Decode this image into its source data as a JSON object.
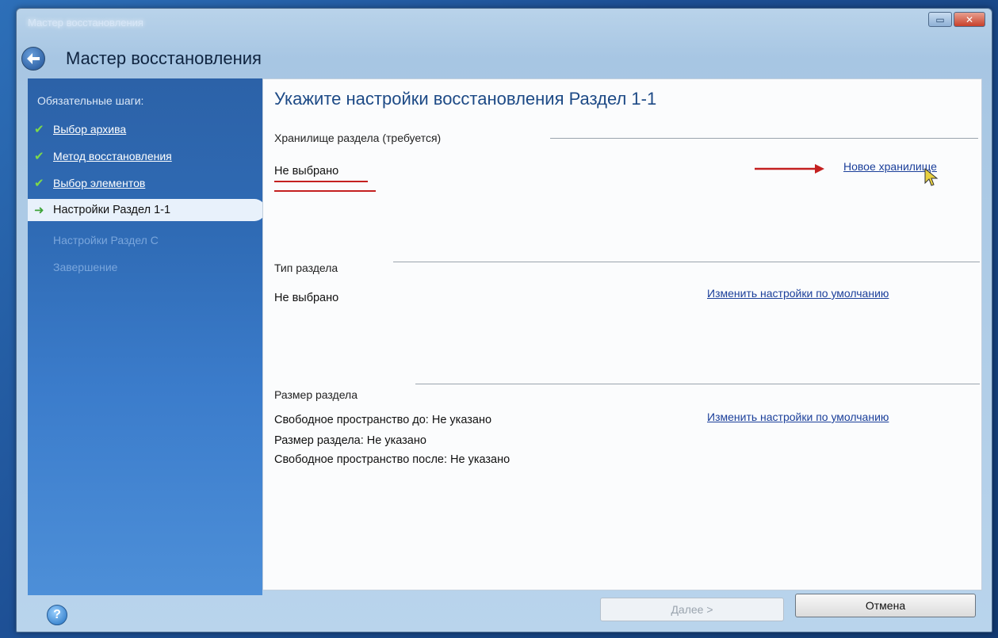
{
  "window": {
    "titlebar_text": "Мастер восстановления",
    "header_title": "Мастер восстановления"
  },
  "sidebar": {
    "heading": "Обязательные шаги:",
    "steps": [
      {
        "label": "Выбор архива",
        "state": "done"
      },
      {
        "label": "Метод восстановления",
        "state": "done"
      },
      {
        "label": "Выбор элементов",
        "state": "done"
      },
      {
        "label": "Настройки Раздел 1-1",
        "state": "current"
      },
      {
        "label": "Настройки Раздел С",
        "state": "future"
      },
      {
        "label": "Завершение",
        "state": "future"
      }
    ]
  },
  "main": {
    "page_title": "Укажите настройки восстановления Раздел 1-1",
    "storage": {
      "label": "Хранилище раздела (требуется)",
      "value": "Не выбрано",
      "link": "Новое хранилище"
    },
    "type": {
      "label": "Тип раздела",
      "value": "Не выбрано",
      "link": "Изменить настройки по умолчанию"
    },
    "size": {
      "label": "Размер раздела",
      "free_before": "Свободное пространство до: Не указано",
      "partition_size": "Размер раздела: Не указано",
      "free_after": "Свободное пространство после: Не указано",
      "link": "Изменить настройки по умолчанию"
    }
  },
  "footer": {
    "help_symbol": "?",
    "next_label": "Далее >",
    "cancel_label": "Отмена"
  },
  "colors": {
    "accent_title": "#1d4a86",
    "annotation_red": "#c42020",
    "link": "#1b3f9a"
  }
}
